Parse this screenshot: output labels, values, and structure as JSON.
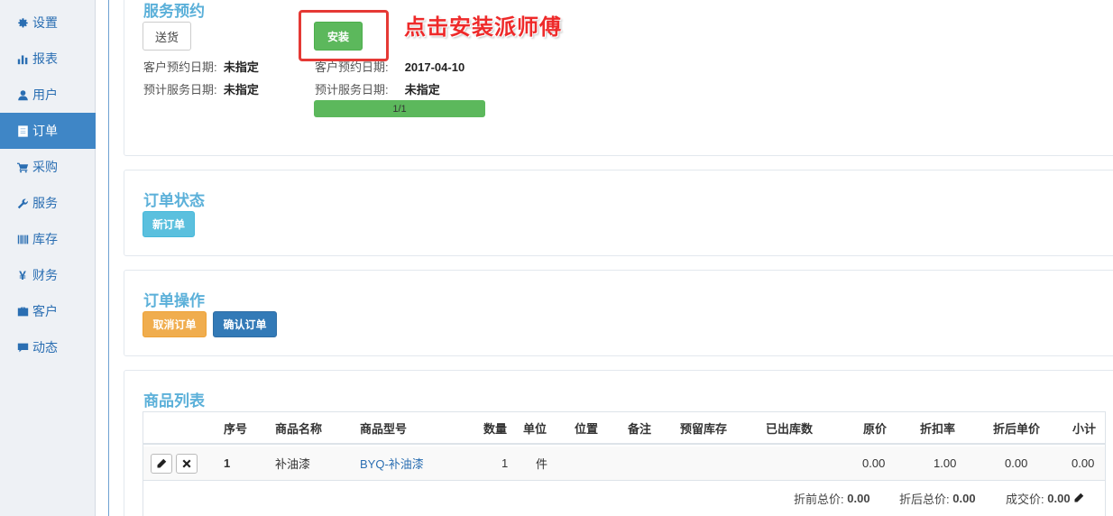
{
  "sidebar": {
    "items": [
      {
        "label": "设置",
        "icon": "gear-icon"
      },
      {
        "label": "报表",
        "icon": "bar-chart-icon"
      },
      {
        "label": "用户",
        "icon": "user-icon"
      },
      {
        "label": "订单",
        "icon": "list-icon",
        "active": true
      },
      {
        "label": "采购",
        "icon": "cart-icon"
      },
      {
        "label": "服务",
        "icon": "wrench-icon"
      },
      {
        "label": "库存",
        "icon": "barcode-icon"
      },
      {
        "label": "财务",
        "icon": "yen-icon"
      },
      {
        "label": "客户",
        "icon": "briefcase-icon"
      },
      {
        "label": "动态",
        "icon": "comment-icon"
      }
    ]
  },
  "service": {
    "title": "服务预约",
    "delivery_button": "送货",
    "install_button": "安装",
    "left": {
      "customer_date_label": "客户预约日期:",
      "customer_date_value": "未指定",
      "planned_date_label": "预计服务日期:",
      "planned_date_value": "未指定"
    },
    "right": {
      "customer_date_label": "客户预约日期:",
      "customer_date_value": "2017-04-10",
      "planned_date_label": "预计服务日期:",
      "planned_date_value": "未指定"
    },
    "progress_text": "1/1",
    "progress_fraction": 1.0
  },
  "annotation": "点击安装派师傅",
  "status": {
    "title": "订单状态",
    "badge": "新订单"
  },
  "operations": {
    "title": "订单操作",
    "cancel": "取消订单",
    "confirm": "确认订单"
  },
  "products": {
    "title": "商品列表",
    "headers": [
      "序号",
      "商品名称",
      "商品型号",
      "数量",
      "单位",
      "位置",
      "备注",
      "预留库存",
      "已出库数",
      "原价",
      "折扣率",
      "折后单价",
      "小计"
    ],
    "rows": [
      {
        "index": "1",
        "name": "补油漆",
        "model": "BYQ-补油漆",
        "qty": "1",
        "unit": "件",
        "location": "",
        "note": "",
        "reserved": "",
        "shipped": "",
        "price": "0.00",
        "discount": "1.00",
        "net_price": "0.00",
        "subtotal": "0.00"
      }
    ],
    "totals": {
      "pre_label": "折前总价:",
      "pre_value": "0.00",
      "post_label": "折后总价:",
      "post_value": "0.00",
      "deal_label": "成交价:",
      "deal_value": "0.00"
    }
  }
}
